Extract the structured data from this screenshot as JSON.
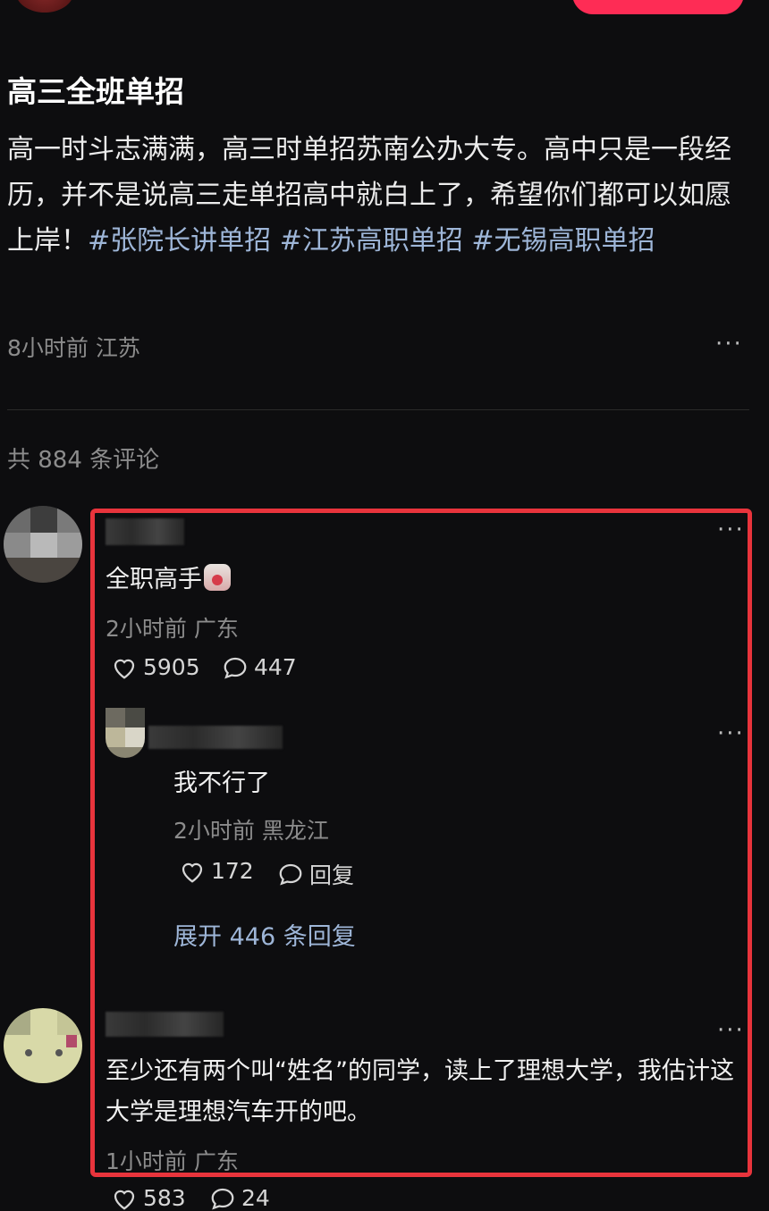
{
  "post": {
    "title": "高三全班单招",
    "body_text": "高一时斗志满满，高三时单招苏南公办大专。高中只是一段经历，并不是说高三走单招高中就白上了，希望你们都可以如愿上岸！",
    "tags": [
      "#张院长讲单招",
      "#江苏高职单招",
      "#无锡高职单招"
    ],
    "meta": "8小时前 江苏",
    "more_label": "···"
  },
  "comments_count_label": "共 884 条评论",
  "comments": [
    {
      "text": "全职高手",
      "meta": "2小时前 广东",
      "likes": "5905",
      "replies": "447",
      "more_label": "···"
    },
    {
      "text": "我不行了",
      "meta": "2小时前 黑龙江",
      "likes": "172",
      "reply_label": "回复",
      "expand_label": "展开 446 条回复",
      "more_label": "···"
    },
    {
      "text": "至少还有两个叫“姓名”的同学，读上了理想大学，我估计这大学是理想汽车开的吧。",
      "meta": "1小时前 广东",
      "likes": "583",
      "replies": "24",
      "more_label": "···"
    }
  ],
  "colors": {
    "background": "#0d0d0f",
    "tag": "#9eb6d8",
    "highlight_border": "#e8343c",
    "follow_button": "#fe2c55"
  },
  "icons": [
    "heart-icon",
    "comment-bubble-icon",
    "more-dots-icon"
  ]
}
